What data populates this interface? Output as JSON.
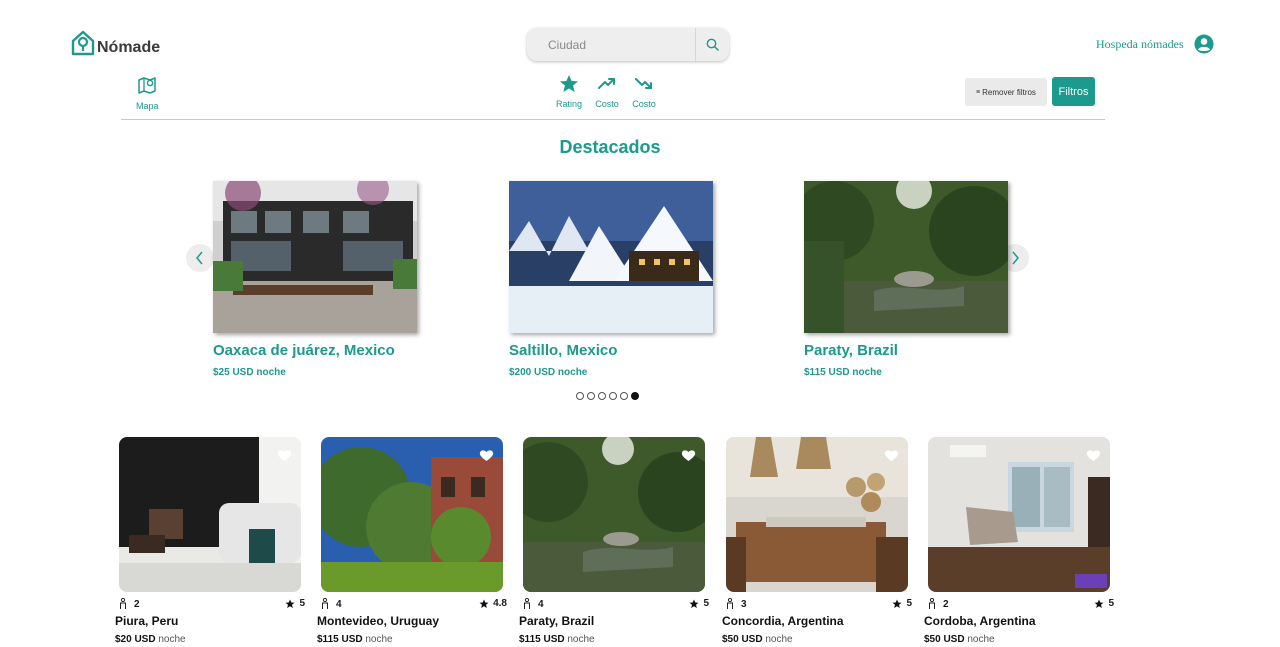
{
  "header": {
    "logo_text": "Nómade",
    "search": {
      "placeholder": "Ciudad"
    },
    "host_link": "Hospeda nómades"
  },
  "filters": {
    "map_label": "Mapa",
    "sort": [
      {
        "label": "Rating",
        "icon": "star-icon"
      },
      {
        "label": "Costo",
        "icon": "trending-up-icon"
      },
      {
        "label": "Costo",
        "icon": "trending-down-icon"
      }
    ],
    "remove_filters": "Remover filtros",
    "filters_button": "Filtros"
  },
  "featured": {
    "title": "Destacados",
    "items": [
      {
        "city": "Oaxaca de juárez, Mexico",
        "price": "$25 USD noche"
      },
      {
        "city": "Saltillo, Mexico",
        "price": "$200 USD noche"
      },
      {
        "city": "Paraty, Brazil",
        "price": "$115 USD noche"
      }
    ],
    "pagination": {
      "total": 6,
      "active": 6
    }
  },
  "listings": [
    {
      "guests": "2",
      "rating": "5",
      "city": "Piura, Peru",
      "price": "$20 USD",
      "unit": "noche"
    },
    {
      "guests": "4",
      "rating": "4.8",
      "city": "Montevideo, Uruguay",
      "price": "$115 USD",
      "unit": "noche"
    },
    {
      "guests": "4",
      "rating": "5",
      "city": "Paraty, Brazil",
      "price": "$115 USD",
      "unit": "noche"
    },
    {
      "guests": "3",
      "rating": "5",
      "city": "Concordia, Argentina",
      "price": "$50 USD",
      "unit": "noche"
    },
    {
      "guests": "2",
      "rating": "5",
      "city": "Cordoba, Argentina",
      "price": "$50 USD",
      "unit": "noche"
    }
  ],
  "colors": {
    "accent": "#1b9a8d",
    "text": "#111111",
    "muted": "#555555"
  }
}
